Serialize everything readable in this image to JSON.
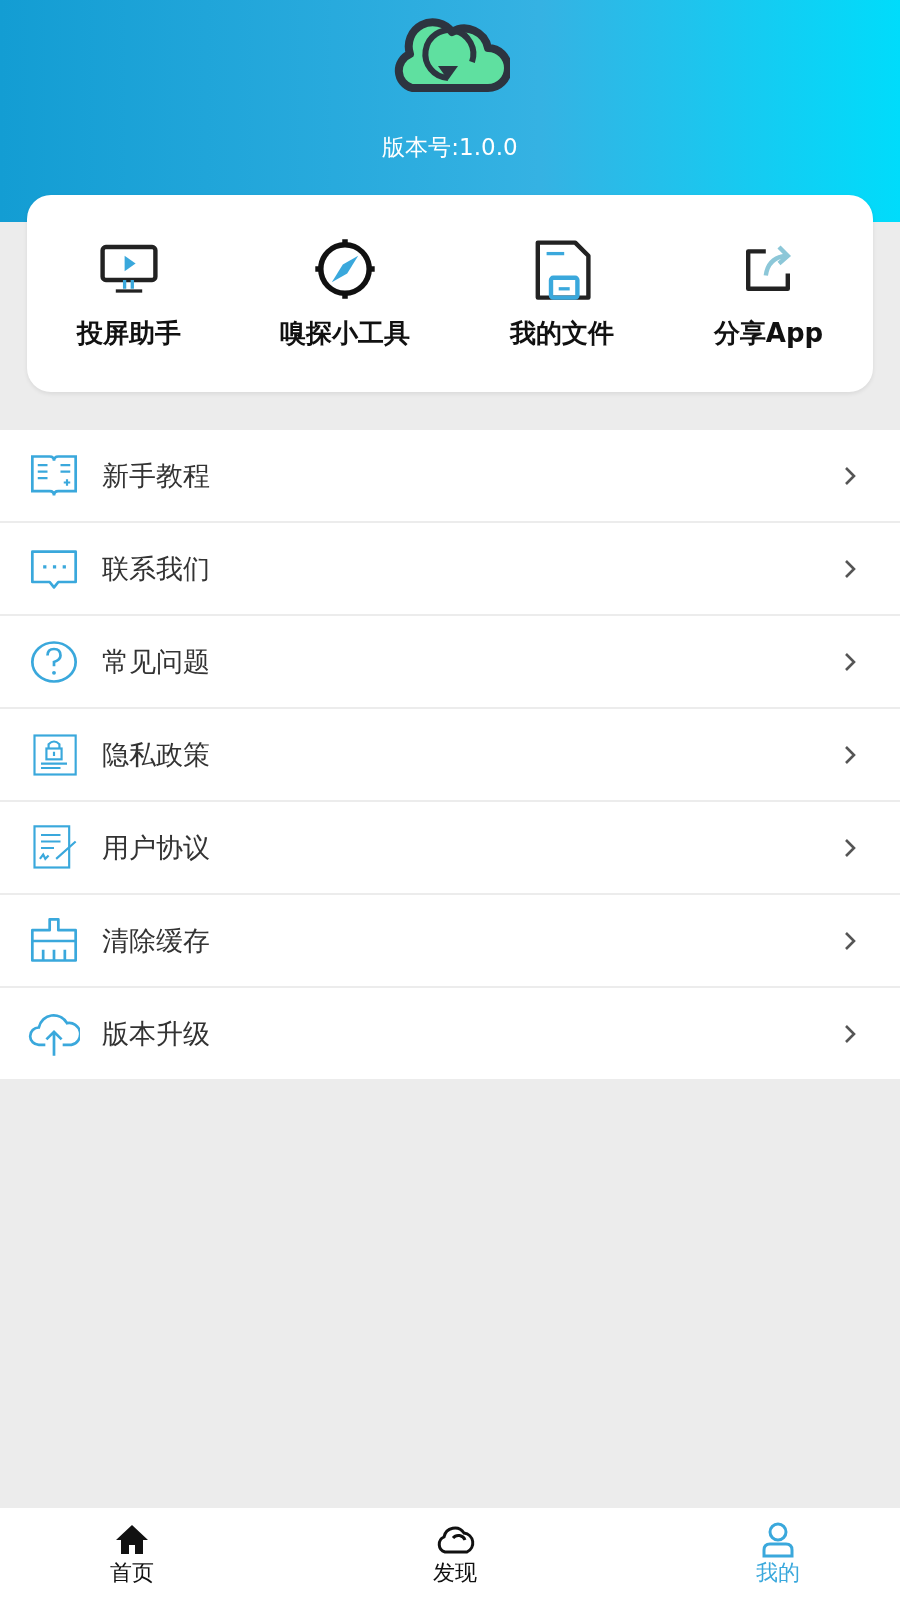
{
  "header": {
    "version": "版本号:1.0.0"
  },
  "tools": [
    {
      "label": "投屏助手"
    },
    {
      "label": "嗅探小工具"
    },
    {
      "label": "我的文件"
    },
    {
      "label": "分享App"
    }
  ],
  "menu": [
    {
      "label": "新手教程"
    },
    {
      "label": "联系我们"
    },
    {
      "label": "常见问题"
    },
    {
      "label": "隐私政策"
    },
    {
      "label": "用户协议"
    },
    {
      "label": "清除缓存"
    },
    {
      "label": "版本升级"
    }
  ],
  "tab_bar": [
    {
      "label": "首页",
      "selected": false
    },
    {
      "label": "发现",
      "selected": false
    },
    {
      "label": "我的",
      "selected": true
    }
  ]
}
